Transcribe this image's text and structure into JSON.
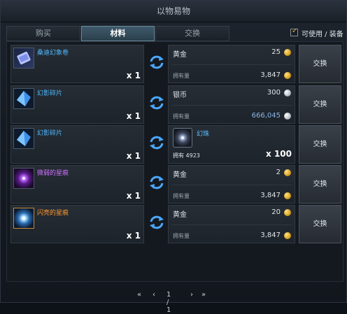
{
  "window": {
    "title": "以物易物"
  },
  "tabs": [
    {
      "label": "购买",
      "active": false
    },
    {
      "label": "材料",
      "active": true
    },
    {
      "label": "交换",
      "active": false
    }
  ],
  "filter": {
    "label": "可使用 / 装备",
    "checked": true
  },
  "rows": [
    {
      "item": {
        "name": "桑迪幻象卷",
        "qty": "x 1",
        "name_color": "#4fb8ff",
        "icon": "scroll-icon"
      },
      "cost": {
        "currency": "黄金",
        "amount": "25",
        "coin": "gold-coin-icon",
        "owned_label": "拥有量",
        "owned": "3,847"
      },
      "button": "交换"
    },
    {
      "item": {
        "name": "幻影碎片",
        "qty": "x 1",
        "name_color": "#4fb8ff",
        "icon": "crystal-shard-icon"
      },
      "cost": {
        "currency": "银币",
        "amount": "300",
        "coin": "silver-coin-icon",
        "owned_label": "拥有量",
        "owned": "666,045"
      },
      "button": "交换"
    },
    {
      "item": {
        "name": "幻影碎片",
        "qty": "x 1",
        "name_color": "#4fb8ff",
        "icon": "crystal-shard-icon"
      },
      "cost": {
        "currency": "幻珠",
        "owned_text": "拥有 4923",
        "qty": "x 100",
        "icon": "phantom-orb-icon"
      },
      "button": "交换"
    },
    {
      "item": {
        "name": "微弱的星痕",
        "qty": "x 1",
        "name_color": "#d070ff",
        "icon": "star-mark-purple-icon"
      },
      "cost": {
        "currency": "黄金",
        "amount": "2",
        "coin": "gold-coin-icon",
        "owned_label": "拥有量",
        "owned": "3,847"
      },
      "button": "交换"
    },
    {
      "item": {
        "name": "闪亮的星痕",
        "qty": "x 1",
        "name_color": "#ff9a30",
        "icon": "star-mark-orange-icon"
      },
      "cost": {
        "currency": "黄金",
        "amount": "20",
        "coin": "gold-coin-icon",
        "owned_label": "拥有量",
        "owned": "3,847"
      },
      "button": "交换"
    }
  ],
  "pager": {
    "first": "«",
    "prev": "‹",
    "page": "1 / 1",
    "next": "›",
    "last": "»"
  }
}
